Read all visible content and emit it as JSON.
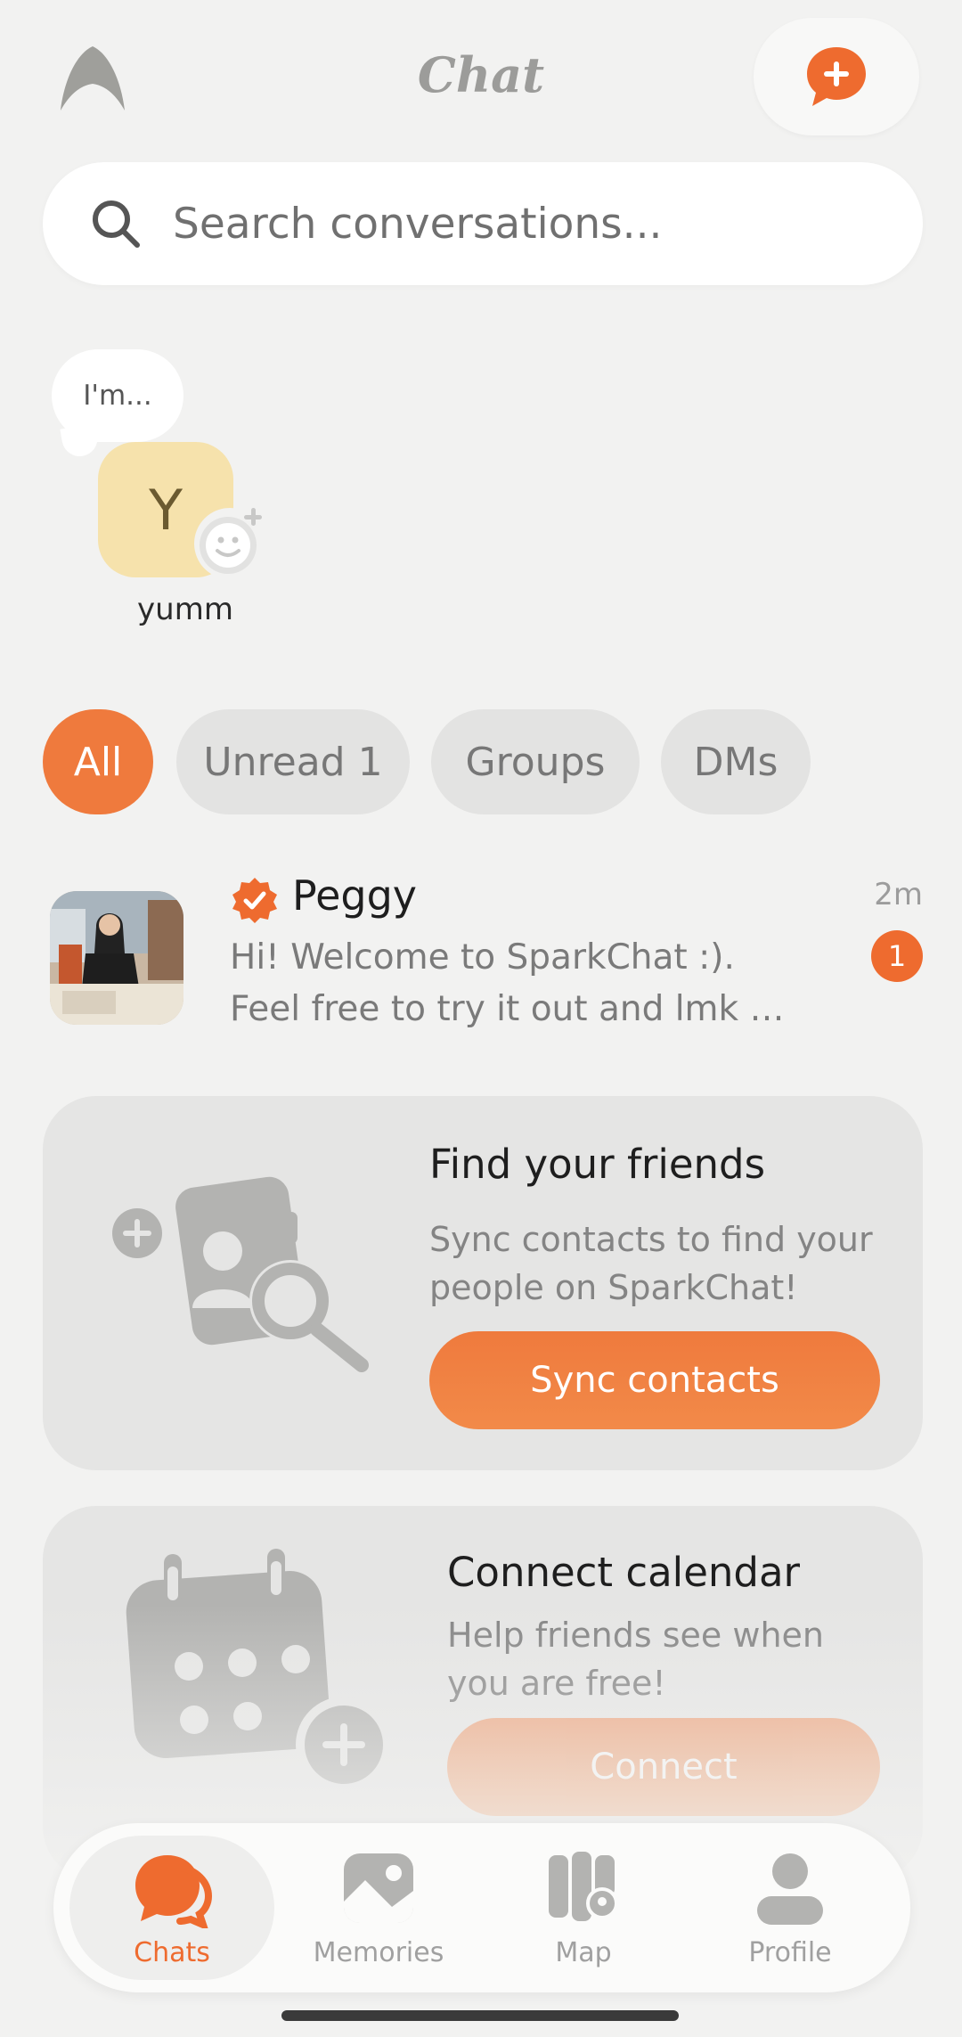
{
  "header": {
    "title": "Chat"
  },
  "search": {
    "placeholder": "Search conversations..."
  },
  "stories": {
    "status_text": "I'm...",
    "user_initial": "Y",
    "user_name": "yumm"
  },
  "filters": [
    {
      "label": "All",
      "active": true
    },
    {
      "label": "Unread 1",
      "active": false
    },
    {
      "label": "Groups",
      "active": false
    },
    {
      "label": "DMs",
      "active": false
    }
  ],
  "chats": [
    {
      "name": "Peggy",
      "verified": true,
      "time": "2m",
      "preview_line1": "Hi! Welcome to SparkChat :).",
      "preview_line2": "Feel free to try it out and lmk …",
      "unread": "1"
    }
  ],
  "cards": {
    "find_friends": {
      "title": "Find your friends",
      "desc_line1": "Sync contacts to find your",
      "desc_line2": "people on SparkChat!",
      "button": "Sync contacts"
    },
    "calendar": {
      "title": "Connect calendar",
      "desc_line1": "Help friends see when",
      "desc_line2": "you are free!",
      "button": "Connect"
    }
  },
  "nav": [
    {
      "label": "Chats",
      "icon": "chats-icon",
      "active": true
    },
    {
      "label": "Memories",
      "icon": "photo-icon",
      "active": false
    },
    {
      "label": "Map",
      "icon": "map-icon",
      "active": false
    },
    {
      "label": "Profile",
      "icon": "profile-icon",
      "active": false
    }
  ],
  "colors": {
    "accent": "#ee6b2f",
    "background": "#f2f2f1"
  }
}
